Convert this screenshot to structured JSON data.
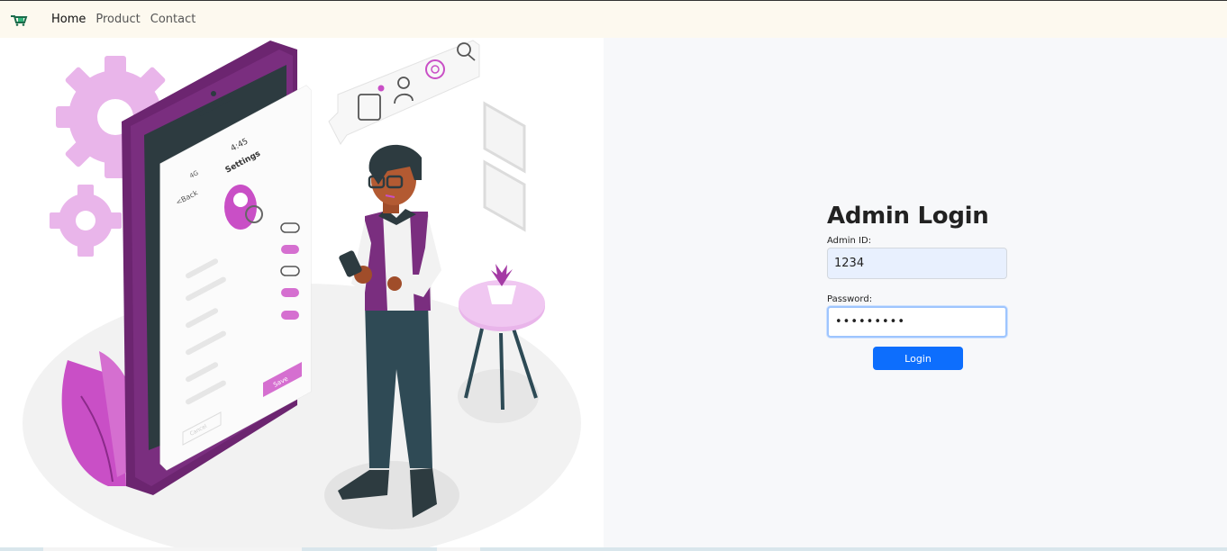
{
  "nav": {
    "brand_icon": "cart-logo-icon",
    "links": [
      {
        "label": "Home",
        "active": true
      },
      {
        "label": "Product",
        "active": false
      },
      {
        "label": "Contact",
        "active": false
      }
    ]
  },
  "illustration": {
    "phone_time": "4:45",
    "phone_title": "Settings",
    "phone_back": "<Back",
    "phone_signal": "4G",
    "phone_save": "Save",
    "phone_cancel": "Cancel"
  },
  "login": {
    "title": "Admin Login",
    "admin_id_label": "Admin ID:",
    "admin_id_value": "1234",
    "password_label": "Password:",
    "password_value": "123456789",
    "button_label": "Login"
  },
  "colors": {
    "primary_button": "#0d6efd",
    "navbar_bg": "#fdf9ef",
    "accent_purple": "#7a2e7f",
    "accent_pink": "#d56fd0"
  }
}
